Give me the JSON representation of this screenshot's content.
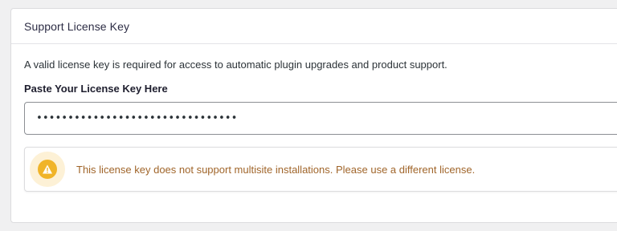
{
  "panel": {
    "title": "Support License Key",
    "description": "A valid license key is required for access to automatic plugin upgrades and product support.",
    "field_label": "Paste Your License Key Here",
    "license_key_masked": "••••••••••••••••••••••••••••••••",
    "notice": {
      "icon": "warning-icon",
      "message": "This license key does not support multisite installations. Please use a different license.",
      "color": "#a0652a",
      "icon_color": "#f0b429",
      "icon_bg": "#fdf1d6"
    }
  }
}
